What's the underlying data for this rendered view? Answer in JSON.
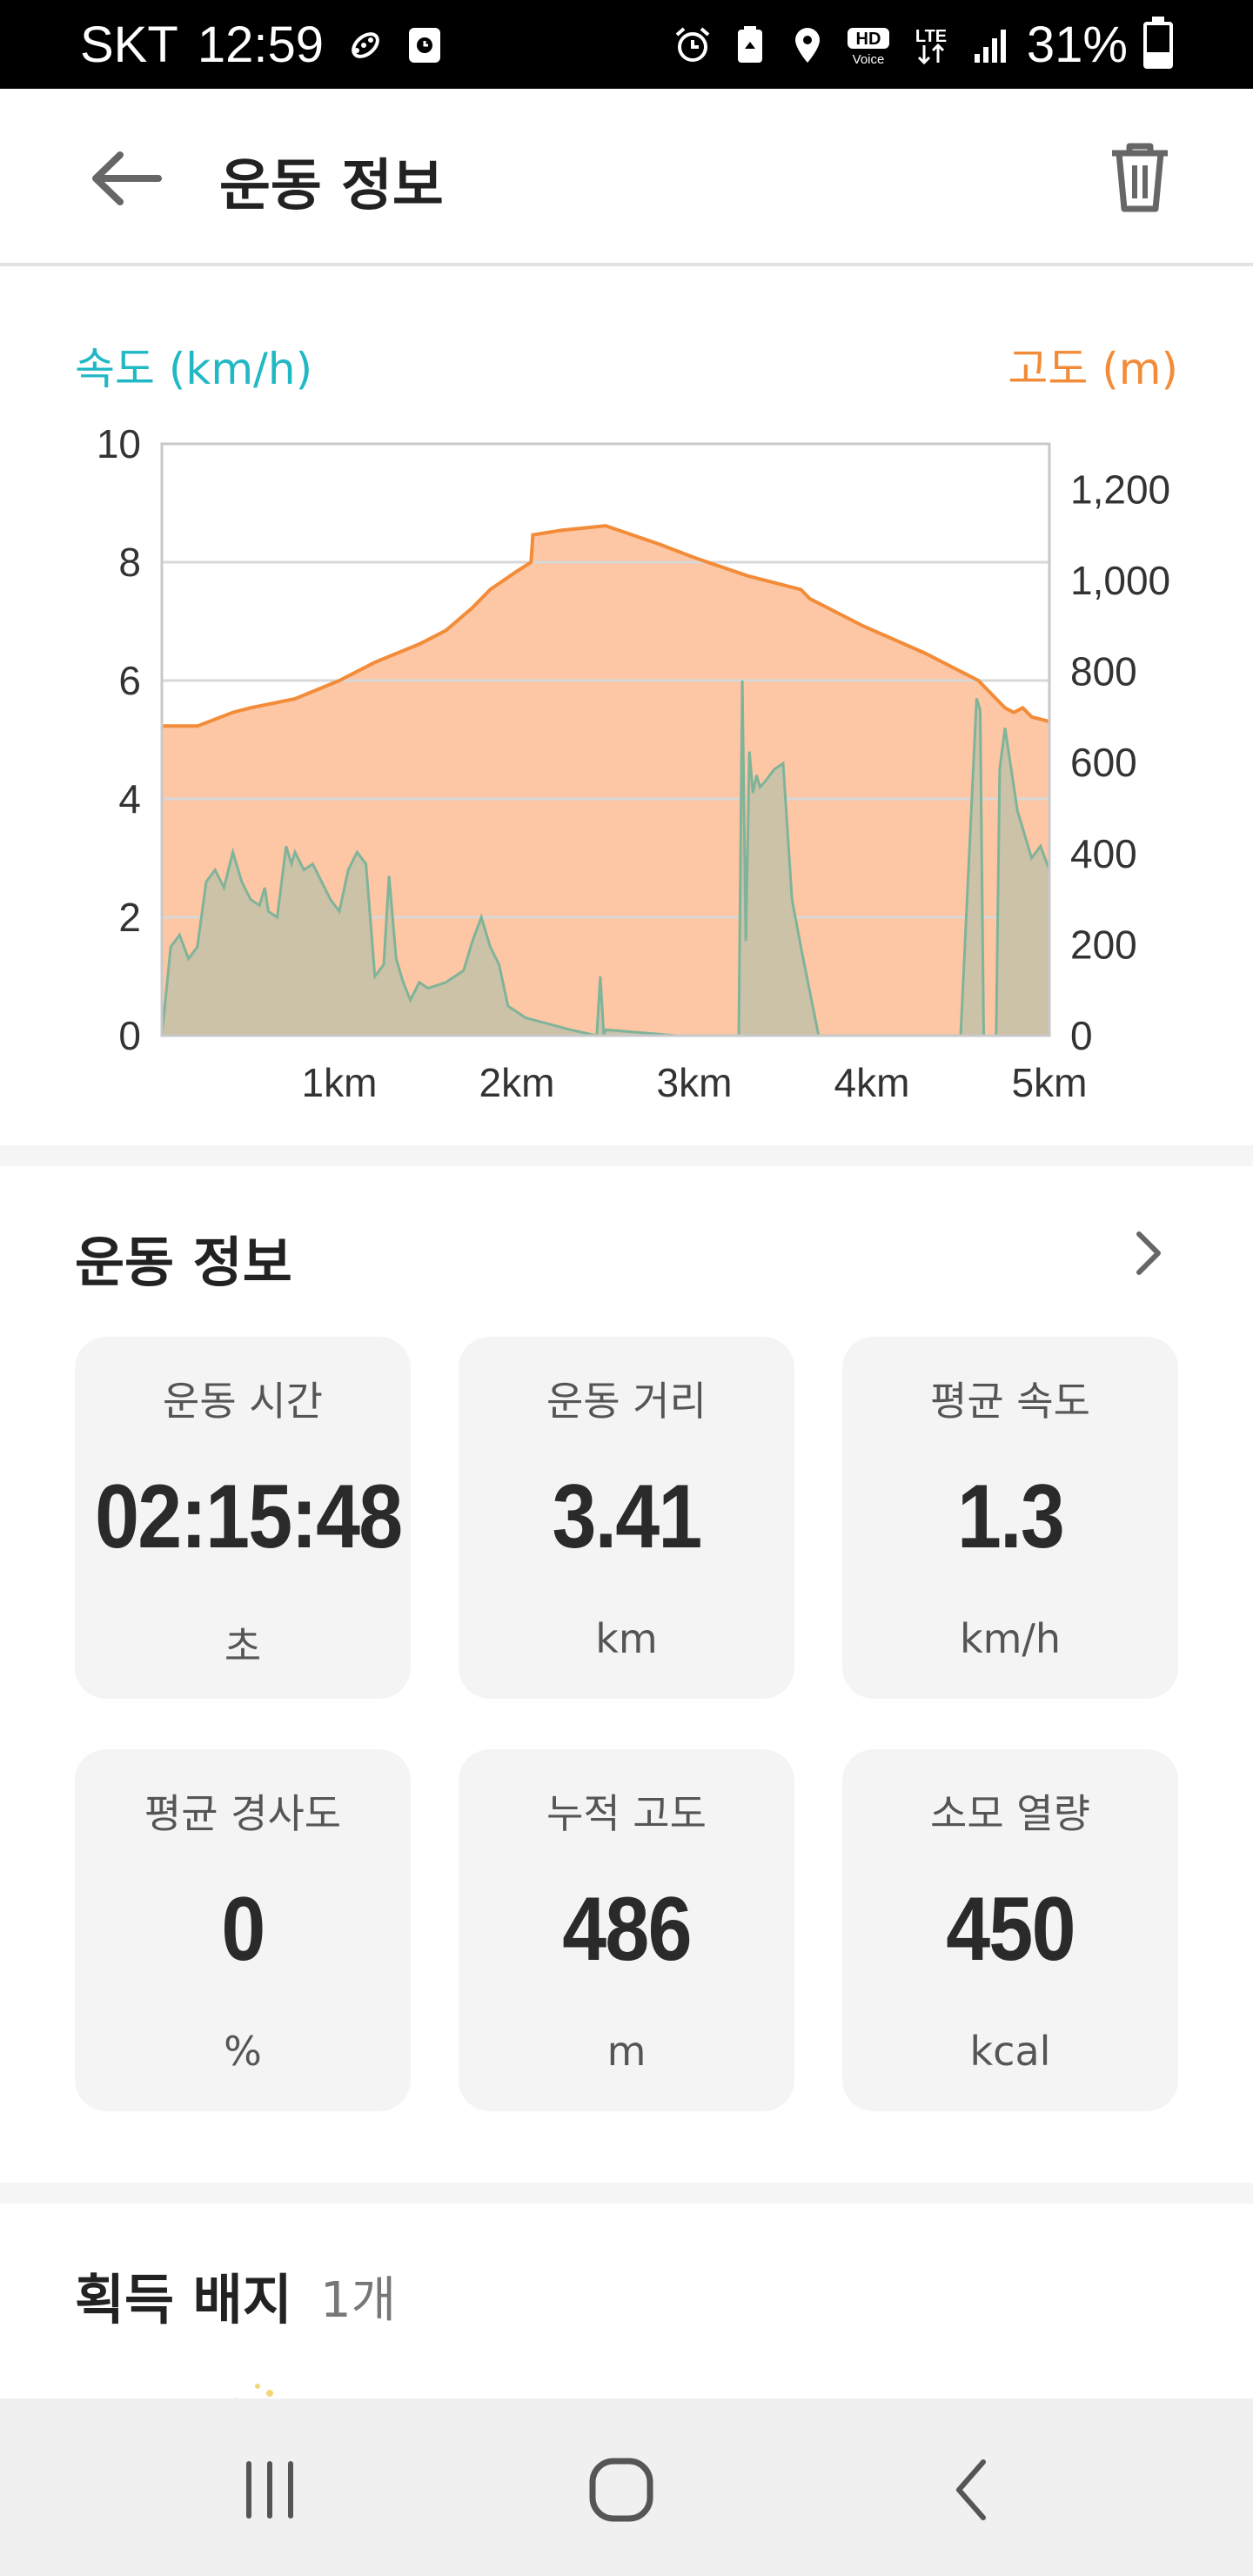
{
  "status_bar": {
    "carrier": "SKT",
    "time": "12:59",
    "battery": "31%",
    "battery_level": 0.31,
    "lte_label": "LTE",
    "hd_label": "HD",
    "voice_label": "Voice",
    "icons": [
      "activity-shoe-icon",
      "app-notification-icon",
      "alarm-icon",
      "recycle-icon",
      "location-icon",
      "hd-voice-icon",
      "lte-icon",
      "signal-icon",
      "battery-icon"
    ]
  },
  "app_bar": {
    "title": "운동 정보",
    "back_icon": "arrow-left-icon",
    "delete_icon": "trash-icon"
  },
  "chart": {
    "speed_legend": "속도 (km/h)",
    "altitude_legend": "고도 (m)",
    "colors": {
      "speed_label": "#20b8c4",
      "altitude_label": "#f28c38",
      "altitude_line": "#f28c38",
      "altitude_fill": "#fdc6a4",
      "speed_line": "#7fb49a",
      "speed_fill": "#c8c2a8"
    }
  },
  "chart_data": {
    "type": "area",
    "xlabel": "",
    "x_unit": "km",
    "x_ticks": [
      "1km",
      "2km",
      "3km",
      "4km",
      "5km"
    ],
    "x_tick_values": [
      1,
      2,
      3,
      4,
      5
    ],
    "xlim": [
      0,
      5
    ],
    "y_left_ticks": [
      "0",
      "2",
      "4",
      "6",
      "8",
      "10"
    ],
    "y_left_tick_values": [
      0,
      2,
      4,
      6,
      8,
      10
    ],
    "ylim_left": [
      0,
      10
    ],
    "y_right_ticks": [
      "0",
      "200",
      "400",
      "600",
      "800",
      "1,000",
      "1,200"
    ],
    "y_right_tick_values": [
      0,
      200,
      400,
      600,
      800,
      1000,
      1200
    ],
    "ylim_right": [
      0,
      1300
    ],
    "grid": true,
    "series": [
      {
        "name": "고도 (m)",
        "axis": "right",
        "x": [
          0,
          0.2,
          0.4,
          0.5,
          0.75,
          1.0,
          1.2,
          1.45,
          1.6,
          1.75,
          1.85,
          2.0,
          2.08,
          2.09,
          2.25,
          2.5,
          2.8,
          3.0,
          3.3,
          3.6,
          3.65,
          3.95,
          4.3,
          4.6,
          4.75,
          4.8,
          4.85,
          4.9,
          5.0
        ],
        "values": [
          680,
          680,
          710,
          720,
          740,
          780,
          820,
          860,
          890,
          940,
          980,
          1020,
          1040,
          1100,
          1110,
          1120,
          1080,
          1050,
          1010,
          980,
          960,
          900,
          840,
          780,
          720,
          710,
          720,
          700,
          690
        ]
      },
      {
        "name": "속도 (km/h)",
        "axis": "left",
        "x": [
          0,
          0.05,
          0.1,
          0.15,
          0.2,
          0.25,
          0.3,
          0.35,
          0.4,
          0.45,
          0.5,
          0.55,
          0.58,
          0.6,
          0.65,
          0.7,
          0.73,
          0.75,
          0.8,
          0.85,
          0.9,
          0.95,
          1.0,
          1.05,
          1.1,
          1.15,
          1.2,
          1.25,
          1.28,
          1.32,
          1.36,
          1.4,
          1.45,
          1.5,
          1.6,
          1.7,
          1.75,
          1.8,
          1.85,
          1.9,
          1.95,
          2.0,
          2.05,
          2.3,
          2.45,
          2.47,
          2.49,
          2.5,
          2.9,
          3.25,
          3.27,
          3.29,
          3.31,
          3.33,
          3.35,
          3.37,
          3.4,
          3.45,
          3.5,
          3.55,
          3.6,
          3.7,
          3.72,
          3.75,
          4.5,
          4.59,
          4.61,
          4.63,
          4.7,
          4.72,
          4.75,
          4.78,
          4.82,
          4.86,
          4.9,
          4.95,
          5.0
        ],
        "values": [
          0,
          1.5,
          1.7,
          1.3,
          1.5,
          2.6,
          2.8,
          2.5,
          3.1,
          2.6,
          2.3,
          2.2,
          2.5,
          2.1,
          2.0,
          3.2,
          2.9,
          3.1,
          2.8,
          2.9,
          2.6,
          2.3,
          2.1,
          2.8,
          3.1,
          2.9,
          1.0,
          1.2,
          2.7,
          1.3,
          0.9,
          0.6,
          0.9,
          0.8,
          0.9,
          1.1,
          1.6,
          2.0,
          1.5,
          1.2,
          0.5,
          0.4,
          0.3,
          0.1,
          0.0,
          1.0,
          0.0,
          0.1,
          0.0,
          0.0,
          6.0,
          1.6,
          4.8,
          4.1,
          4.4,
          4.2,
          4.3,
          4.5,
          4.6,
          2.3,
          1.5,
          0.0,
          0.0,
          0.0,
          0.0,
          5.7,
          5.5,
          0.0,
          0.0,
          4.5,
          5.2,
          4.6,
          3.8,
          3.4,
          3.0,
          3.2,
          2.8
        ]
      }
    ]
  },
  "stats": {
    "title": "운동 정보",
    "more_icon": "chevron-right-icon",
    "cards": [
      {
        "label": "운동 시간",
        "value": "02:15:48",
        "unit": "초"
      },
      {
        "label": "운동 거리",
        "value": "3.41",
        "unit": "km"
      },
      {
        "label": "평균 속도",
        "value": "1.3",
        "unit": "km/h"
      },
      {
        "label": "평균 경사도",
        "value": "0",
        "unit": "%"
      },
      {
        "label": "누적 고도",
        "value": "486",
        "unit": "m"
      },
      {
        "label": "소모 열량",
        "value": "450",
        "unit": "kcal"
      }
    ]
  },
  "badges": {
    "title": "획득 배지",
    "count": "1개",
    "badge_icon": "badge-icon"
  },
  "nav_bar": {
    "icons": [
      "recent-apps-icon",
      "home-icon",
      "nav-back-icon"
    ]
  }
}
